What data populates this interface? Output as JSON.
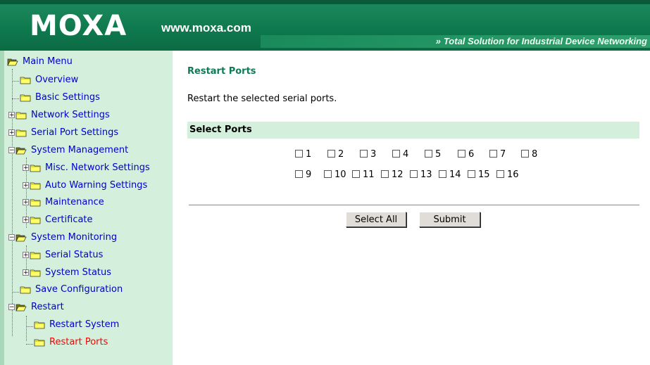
{
  "header": {
    "logo": "MOXA",
    "url": "www.moxa.com",
    "tagline_arrows": "»",
    "tagline": "Total Solution for Industrial Device Networking"
  },
  "colors": {
    "header_green": "#0f7a4e",
    "sidebar_bg": "#d4f0dd",
    "link_blue": "#0000cc",
    "active_red": "#ff0000",
    "title_green": "#107a55"
  },
  "menu": {
    "main": "Main Menu",
    "overview": "Overview",
    "basic_settings": "Basic Settings",
    "network_settings": "Network Settings",
    "serial_port_settings": "Serial Port Settings",
    "system_management": "System Management",
    "misc_network_settings": "Misc. Network Settings",
    "auto_warning_settings": "Auto Warning Settings",
    "maintenance": "Maintenance",
    "certificate": "Certificate",
    "system_monitoring": "System Monitoring",
    "serial_status": "Serial Status",
    "system_status": "System Status",
    "save_configuration": "Save Configuration",
    "restart": "Restart",
    "restart_system": "Restart System",
    "restart_ports": "Restart Ports"
  },
  "main": {
    "title": "Restart Ports",
    "description": "Restart the selected serial ports.",
    "section_title": "Select Ports",
    "ports": [
      "1",
      "2",
      "3",
      "4",
      "5",
      "6",
      "7",
      "8",
      "9",
      "10",
      "11",
      "12",
      "13",
      "14",
      "15",
      "16"
    ],
    "select_all_label": "Select All",
    "submit_label": "Submit"
  }
}
